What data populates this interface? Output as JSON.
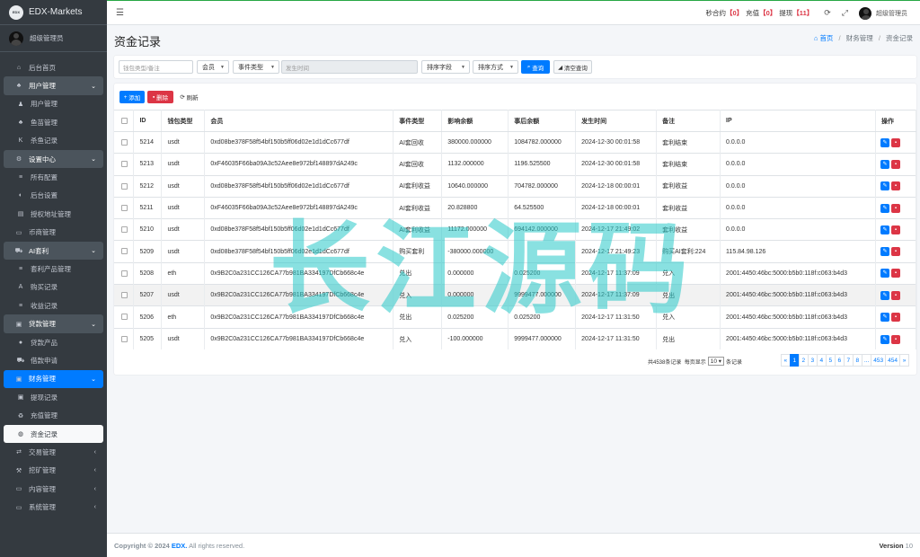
{
  "colors": {
    "accent": "#007bff",
    "danger": "#dc3545",
    "sidebar_bg": "#343a40",
    "watermark": "#28c8c8"
  },
  "brand": {
    "logo_text": "EDX",
    "name": "EDX-Markets"
  },
  "sidebar": {
    "username": "超级管理员",
    "items": [
      {
        "label": "后台首页",
        "icon": "home-icon",
        "level": "top"
      },
      {
        "label": "用户管理",
        "icon": "users-icon",
        "level": "header"
      },
      {
        "label": "用户管理",
        "icon": "user-icon",
        "level": "sub"
      },
      {
        "label": "鱼苗管理",
        "icon": "users-icon",
        "level": "sub"
      },
      {
        "label": "杀鱼记录",
        "icon": "k-icon",
        "level": "sub"
      },
      {
        "label": "设置中心",
        "icon": "gear-icon",
        "level": "header"
      },
      {
        "label": "所有配置",
        "icon": "list-icon",
        "level": "sub"
      },
      {
        "label": "后台设置",
        "icon": "adjust-icon",
        "level": "sub"
      },
      {
        "label": "授权地址管理",
        "icon": "file-icon",
        "level": "sub"
      },
      {
        "label": "币商管理",
        "icon": "card-icon",
        "level": "top"
      },
      {
        "label": "AI套利",
        "icon": "car-icon",
        "level": "header"
      },
      {
        "label": "套利产品管理",
        "icon": "list-icon",
        "level": "sub"
      },
      {
        "label": "购买记录",
        "icon": "a-icon",
        "level": "sub"
      },
      {
        "label": "收益记录",
        "icon": "list-icon",
        "level": "sub"
      },
      {
        "label": "贷款管理",
        "icon": "money-icon",
        "level": "header"
      },
      {
        "label": "贷款产品",
        "icon": "coin-icon",
        "level": "sub"
      },
      {
        "label": "借款申请",
        "icon": "truck-icon",
        "level": "sub"
      },
      {
        "label": "财务管理",
        "icon": "money-icon",
        "level": "active"
      },
      {
        "label": "提现记录",
        "icon": "money-icon",
        "level": "sub"
      },
      {
        "label": "充值管理",
        "icon": "recycle-icon",
        "level": "sub"
      },
      {
        "label": "资金记录",
        "icon": "globe-icon",
        "level": "current"
      },
      {
        "label": "交易管理",
        "icon": "exchange-icon",
        "level": "collapsed"
      },
      {
        "label": "挖矿管理",
        "icon": "pickaxe-icon",
        "level": "collapsed"
      },
      {
        "label": "内容管理",
        "icon": "card-icon",
        "level": "collapsed"
      },
      {
        "label": "系统管理",
        "icon": "monitor-icon",
        "level": "collapsed"
      }
    ]
  },
  "navbar": {
    "seconds_label": "秒合约",
    "seconds_count": "【0】",
    "recharge_label": "充值",
    "recharge_count": "【0】",
    "withdraw_label": "提现",
    "withdraw_count": "【11】",
    "username": "超级管理员"
  },
  "header": {
    "title": "资金记录",
    "breadcrumb": [
      "首页",
      "财务管理",
      "资金记录"
    ]
  },
  "filters": {
    "wallet_placeholder": "钱包类型/备注",
    "member_label": "会员",
    "event_type_label": "事件类型",
    "time_placeholder": "发生时间",
    "sort_field_label": "排序字段",
    "sort_method_label": "排序方式",
    "search_label": "查询",
    "clear_label": "清空查询"
  },
  "toolbar": {
    "add_label": "添加",
    "delete_label": "删除",
    "refresh_label": "刷新"
  },
  "table": {
    "columns": [
      "ID",
      "钱包类型",
      "会员",
      "事件类型",
      "影响余额",
      "事后余额",
      "发生时间",
      "备注",
      "IP",
      "操作"
    ],
    "rows": [
      [
        "5214",
        "usdt",
        "0xd08be378F58f54bf150b5ff06d02e1d1dCc677df",
        "AI套回收",
        "380000.000000",
        "1084782.000000",
        "2024-12-30 00:01:58",
        "套利结束",
        "0.0.0.0"
      ],
      [
        "5213",
        "usdt",
        "0xF46035F66ba09A3c52Aee8e972bf148897dA249c",
        "AI套回收",
        "1132.000000",
        "1196.525500",
        "2024-12-30 00:01:58",
        "套利结束",
        "0.0.0.0"
      ],
      [
        "5212",
        "usdt",
        "0xd08be378F58f54bf150b5ff06d02e1d1dCc677df",
        "AI套利收益",
        "10640.000000",
        "704782.000000",
        "2024-12-18 00:00:01",
        "套利收益",
        "0.0.0.0"
      ],
      [
        "5211",
        "usdt",
        "0xF46035F66ba09A3c52Aee8e972bf148897dA249c",
        "AI套利收益",
        "20.828800",
        "64.525500",
        "2024-12-18 00:00:01",
        "套利收益",
        "0.0.0.0"
      ],
      [
        "5210",
        "usdt",
        "0xd08be378F58f54bf150b5ff06d02e1d1dCc677df",
        "AI套利收益",
        "11172.000000",
        "694142.000000",
        "2024-12-17 21:49:02",
        "套利收益",
        "0.0.0.0"
      ],
      [
        "5209",
        "usdt",
        "0xd08be378F58f54bf150b5ff06d02e1d1dCc677df",
        "购买套利",
        "-380000.000000",
        "",
        "2024-12-17 21:49:23",
        "购买AI套利:224",
        "115.84.98.126"
      ],
      [
        "5208",
        "eth",
        "0x9B2C0a231CC126CA77b981BA334197DfCb668c4e",
        "兑出",
        "0.000000",
        "0.025200",
        "2024-12-17 11:37:09",
        "兑入",
        "2001:4450:46bc:5000:b5b0:118f:c063:b4d3"
      ],
      [
        "5207",
        "usdt",
        "0x9B2C0a231CC126CA77b981BA334197DfCb668c4e",
        "兑入",
        "0.000000",
        "9999477.000000",
        "2024-12-17 11:37:09",
        "兑出",
        "2001:4450:46bc:5000:b5b0:118f:c063:b4d3"
      ],
      [
        "5206",
        "eth",
        "0x9B2C0a231CC126CA77b981BA334197DfCb668c4e",
        "兑出",
        "0.025200",
        "0.025200",
        "2024-12-17 11:31:50",
        "兑入",
        "2001:4450:46bc:5000:b5b0:118f:c063:b4d3"
      ],
      [
        "5205",
        "usdt",
        "0x9B2C0a231CC126CA77b981BA334197DfCb668c4e",
        "兑入",
        "-100.000000",
        "9999477.000000",
        "2024-12-17 11:31:50",
        "兑出",
        "2001:4450:46bc:5000:b5b0:118f:c063:b4d3"
      ]
    ]
  },
  "pagination": {
    "total_text": "共4538条记录",
    "per_page_prefix": "每页显示",
    "per_page_value": "10",
    "per_page_suffix": "条记录",
    "pages": [
      "«",
      "1",
      "2",
      "3",
      "4",
      "5",
      "6",
      "7",
      "8",
      "...",
      "453",
      "454",
      "»"
    ],
    "active_page": "1"
  },
  "footer": {
    "copyright_prefix": "Copyright © 2024",
    "copyright_brand": "EDX.",
    "copyright_suffix": "All rights reserved.",
    "version_label": "Version",
    "version_value": "10"
  },
  "watermark": {
    "text": "长江源码"
  }
}
